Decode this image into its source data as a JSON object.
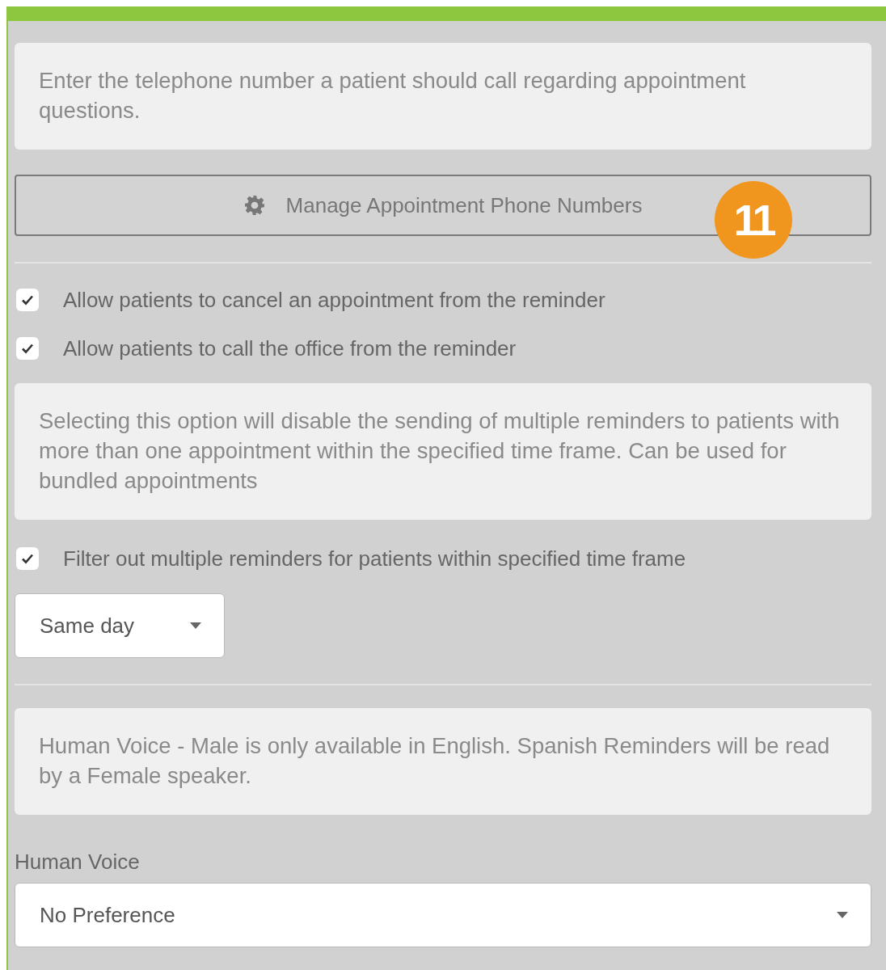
{
  "items": [
    {
      "kind": "note",
      "text": "Enter the telephone number a patient should call regarding appointment questions."
    },
    {
      "kind": "button",
      "label": "Manage Appointment Phone Numbers",
      "badge": "11"
    },
    {
      "kind": "divider"
    },
    {
      "kind": "checkbox",
      "label": "Allow patients to cancel an appointment from the reminder",
      "checked": true
    },
    {
      "kind": "checkbox",
      "label": "Allow patients to call the office from the reminder",
      "checked": true
    },
    {
      "kind": "note",
      "text": "Selecting this option will disable the sending of multiple reminders to patients with more than one appointment within the specified time frame. Can be used for bundled appointments"
    },
    {
      "kind": "checkbox",
      "label": "Filter out multiple reminders for patients within specified time frame",
      "checked": true
    },
    {
      "kind": "select",
      "value": "Same day",
      "wide": false
    },
    {
      "kind": "divider"
    },
    {
      "kind": "note",
      "text": "Human Voice - Male is only available in English. Spanish Reminders will be read by a Female speaker."
    },
    {
      "kind": "label",
      "text": "Human Voice"
    },
    {
      "kind": "select",
      "value": "No Preference",
      "wide": true
    }
  ]
}
